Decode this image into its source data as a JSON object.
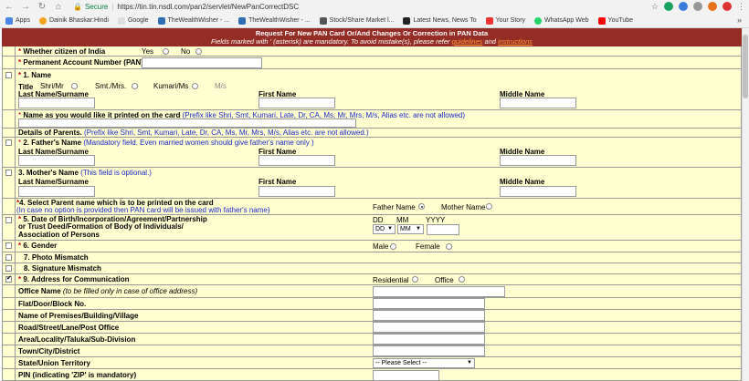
{
  "browser": {
    "secure_label": "Secure",
    "separator": "|",
    "url": "https://tin.tin.nsdl.com/pan2/servlet/NewPanCorrectDSC",
    "bookmarks": [
      "Apps",
      "Dainik Bhaskar:Hindi",
      "Google",
      "TheWealthWisher - ...",
      "TheWealthWisher - ...",
      "Stock/Share Market l...",
      "Latest News, News To",
      "Your Story",
      "WhatsApp Web",
      "YouTube"
    ],
    "more": "»"
  },
  "form": {
    "header_title": "Request For New PAN Card Or/And Changes Or Correction in PAN Data",
    "header_note_pre": "Fields marked with ' (asterisk) are mandatory.   To avoid mistake(s), please refer",
    "header_link1": "guidelines",
    "header_and": "and",
    "header_link2": "instructions",
    "citizen_label": "Whether citizen of India",
    "yes": "Yes",
    "no": "No",
    "pan_label": "Permanent Account Number (PAN)",
    "name_label": "1. Name",
    "title_label": "Title",
    "title_opts": [
      "Shri/Mr",
      "Smt./Mrs.",
      "Kumari/Ms",
      "M/s"
    ],
    "last_name": "Last Name/Surname",
    "first_name": "First Name",
    "middle_name": "Middle Name",
    "print_name_label": "Name as you would like it printed on the card",
    "print_name_hint": "(Prefix like Shri, Smt, Kumari, Late, Dr, CA, Ms, Mr, Mrs, M/s, Alias etc. are not allowed)",
    "parents_label": "Details of Parents.",
    "parents_hint": "(Prefix like Shri, Smt, Kumari, Late, Dr, CA, Ms, Mr, Mrs, M/s, Alias etc. are not allowed.)",
    "father_label": "2. Father's Name",
    "father_hint": "(Mandatory field. Even married women should give father's name only )",
    "mother_label": "3. Mother's Name",
    "mother_hint": "(This field is optional.)",
    "parent_print_label": "4. Select Parent name which is to be printed on the card",
    "parent_print_hint": "(In case no option is provided then PAN card will be issued with father's name)",
    "father_name_opt": "Father Name",
    "mother_name_opt": "Mother Name",
    "dob_label_1": "5. Date of Birth/Incorporation/Agreement/Partnership",
    "dob_label_2": "or Trust Deed/Formation of Body of Individuals/",
    "dob_label_3": "Association of Persons",
    "dd": "DD",
    "mm": "MM",
    "yyyy": "YYYY",
    "gender_label": "6. Gender",
    "male": "Male",
    "female": "Female",
    "photo_label": "7. Photo Mismatch",
    "sign_label": "8. Signature Mismatch",
    "address_label": "9. Address for Communication",
    "residential": "Residential",
    "office": "Office",
    "office_name_label": "Office Name",
    "office_name_hint": "(to be filled only in case of office address)",
    "flat_label": "Flat/Door/Block No.",
    "premises_label": "Name of Premises/Building/Village",
    "road_label": "Road/Street/Lane/Post Office",
    "area_label": "Area/Locality/Taluka/Sub-Division",
    "town_label": "Town/City/District",
    "state_label": "State/Union Territory",
    "state_select": "-- Please Select --",
    "pin_label": "PIN (indicating 'ZIP' is mandatory)"
  }
}
